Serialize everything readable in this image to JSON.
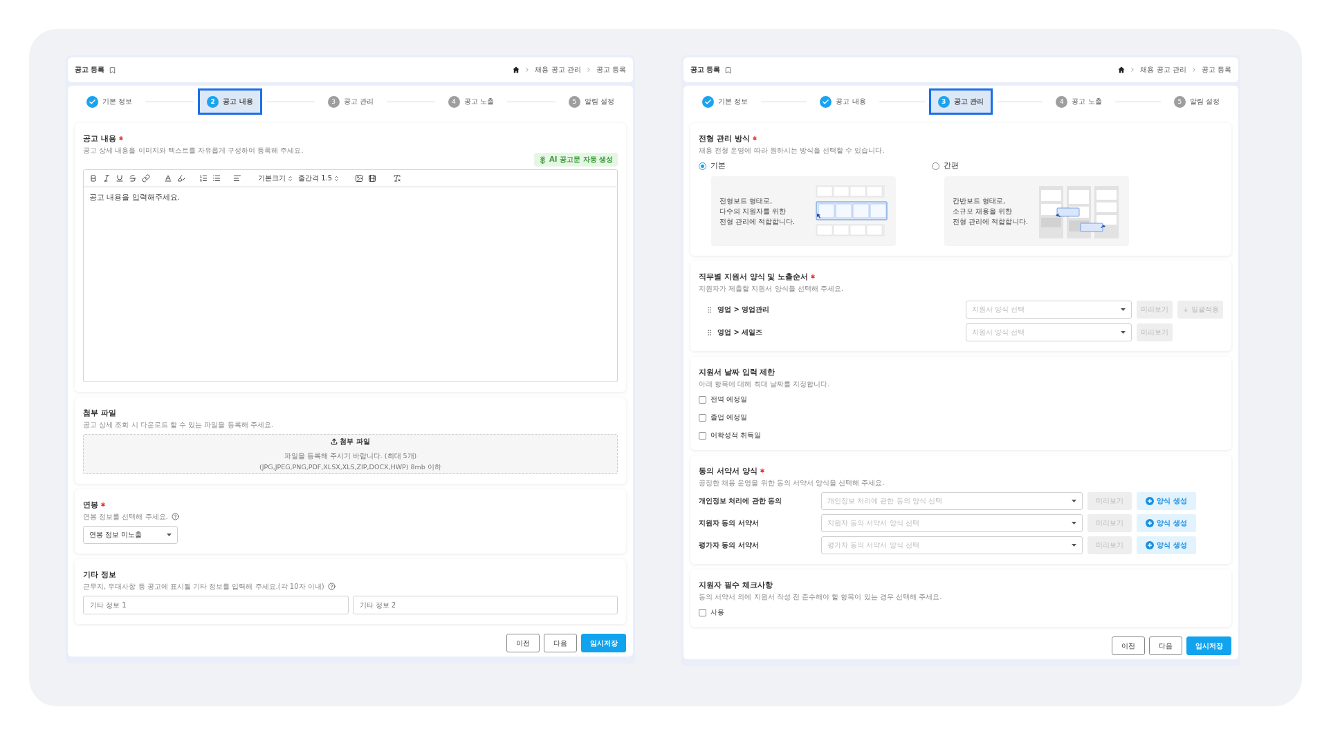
{
  "panels": [
    {
      "title": "공고 등록",
      "breadcrumbs": [
        "채용 공고 관리",
        "공고 등록"
      ],
      "steps": [
        {
          "label": "기본 정보",
          "done": true,
          "selected": false
        },
        {
          "number": "2",
          "label": "공고 내용",
          "done": false,
          "selected": true
        },
        {
          "number": "3",
          "label": "공고 관리",
          "done": false,
          "selected": false
        },
        {
          "number": "4",
          "label": "공고 노출",
          "done": false,
          "selected": false
        },
        {
          "number": "5",
          "label": "알림 설정",
          "done": false,
          "selected": false
        }
      ],
      "sections": [
        {
          "kind": "editor",
          "title": "공고 내용",
          "required": true,
          "description": "공고 상세 내용을 이미지와 텍스트를 자유롭게 구성하여 등록해 주세요.",
          "ai_button": "AI 공고문 자동 생성",
          "toolbar": {
            "size": "기본크기",
            "line_height": "줄간격 1.5"
          },
          "placeholder": "공고 내용을 입력해주세요."
        },
        {
          "kind": "upload",
          "title": "첨부 파일",
          "required": false,
          "description": "공고 상세 조회 시 다운로드 할 수 있는 파일을 등록해 주세요.",
          "button": "첨부 파일",
          "hint": "파일을 등록해 주시기 바랍니다. (최대 5개)",
          "formats": "(JPG,JPEG,PNG,PDF,XLSX,XLS,ZIP,DOCX,HWP) 8mb 이하"
        },
        {
          "kind": "select",
          "title": "연봉",
          "required": true,
          "description": "연봉 정보를 선택해 주세요.",
          "help": true,
          "value": "연봉 정보 미노출"
        },
        {
          "kind": "text_inputs",
          "title": "기타 정보",
          "required": false,
          "description": "근무지, 우대사항 등 공고에 표시될 기타 정보를 입력해 주세요.(각 10자 이내)",
          "help": true,
          "inputs": [
            {
              "placeholder": "기타 정보 1"
            },
            {
              "placeholder": "기타 정보 2"
            }
          ]
        }
      ],
      "buttons": [
        {
          "label": "이전",
          "kind": "outline"
        },
        {
          "label": "다음",
          "kind": "outline"
        },
        {
          "label": "임시저장",
          "kind": "primary"
        }
      ]
    },
    {
      "title": "공고 등록",
      "breadcrumbs": [
        "채용 공고 관리",
        "공고 등록"
      ],
      "steps": [
        {
          "label": "기본 정보",
          "done": true,
          "selected": false
        },
        {
          "label": "공고 내용",
          "done": true,
          "selected": false
        },
        {
          "number": "3",
          "label": "공고 관리",
          "done": false,
          "selected": true
        },
        {
          "number": "4",
          "label": "공고 노출",
          "done": false,
          "selected": false
        },
        {
          "number": "5",
          "label": "알림 설정",
          "done": false,
          "selected": false
        }
      ],
      "sections": [
        {
          "kind": "radio_cards",
          "title": "전형 관리 방식",
          "required": true,
          "description": "채용 전형 운영에 따라 원하시는 방식을 선택할 수 있습니다.",
          "options": [
            {
              "label": "기본",
              "selected": true,
              "kind": "board",
              "text": [
                "전형보드 형태로,",
                "다수의 지원자를 위한",
                "전형 관리에 적합합니다."
              ]
            },
            {
              "label": "간편",
              "selected": false,
              "kind": "kanban",
              "text": [
                "칸반보드 형태로,",
                "소규모 채용을 위한",
                "전형 관리에 적합합니다."
              ]
            }
          ]
        },
        {
          "kind": "form_rows",
          "title": "직무별 지원서 양식 및 노출순서",
          "required": true,
          "description": "지원자가 제출할 지원서 양식을 선택해 주세요.",
          "rows": [
            {
              "label": "영업 > 영업관리",
              "placeholder": "지원서 양식 선택",
              "preview": "미리보기",
              "disabled": true,
              "apply": "일괄적용"
            },
            {
              "label": "영업 > 세일즈",
              "placeholder": "지원서 양식 선택",
              "preview": "미리보기",
              "disabled": true
            }
          ]
        },
        {
          "kind": "checkboxes",
          "title": "지원서 날짜 입력 제한",
          "required": false,
          "description": "아래 항목에 대해 최대 날짜를 지정합니다.",
          "items": [
            {
              "label": "전역 예정일",
              "checked": false
            },
            {
              "label": "졸업 예정일",
              "checked": false
            },
            {
              "label": "어학성적 취득일",
              "checked": false
            }
          ]
        },
        {
          "kind": "consent_rows",
          "title": "동의 서약서 양식",
          "required": true,
          "description": "공정한 채용 운영을 위한 동의 서약서 양식을 선택해 주세요.",
          "rows": [
            {
              "label": "개인정보 처리에 관한 동의",
              "placeholder": "개인정보 처리에 관한 동의 양식 선택",
              "preview": "미리보기",
              "disabled": true,
              "create": "양식 생성"
            },
            {
              "label": "지원자 동의 서약서",
              "placeholder": "지원자 동의 서약서 양식 선택",
              "preview": "미리보기",
              "disabled": true,
              "create": "양식 생성"
            },
            {
              "label": "평가자 동의 서약서",
              "placeholder": "평가자 동의 서약서 양식 선택",
              "preview": "미리보기",
              "disabled": true,
              "create": "양식 생성"
            }
          ]
        },
        {
          "kind": "checkboxes",
          "title": "지원자 필수 체크사항",
          "required": false,
          "description": "동의 서약서 외에 지원서 작성 전 준수해야 할 항목이 있는 경우 선택해 주세요.",
          "items": [
            {
              "label": "사용",
              "checked": false
            }
          ]
        }
      ],
      "buttons": [
        {
          "label": "이전",
          "kind": "outline"
        },
        {
          "label": "다음",
          "kind": "outline"
        },
        {
          "label": "임시저장",
          "kind": "primary"
        }
      ]
    }
  ]
}
